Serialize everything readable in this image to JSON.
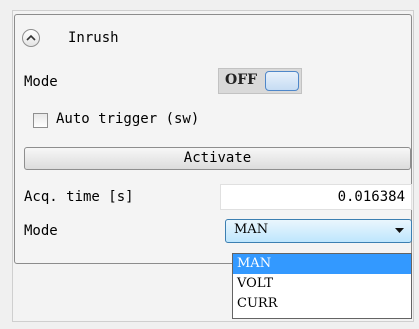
{
  "section": {
    "title": "Inrush",
    "icon": "chevron-up-icon"
  },
  "mode_toggle": {
    "label": "Mode",
    "state": "OFF"
  },
  "auto_trigger": {
    "label": "Auto trigger (sw)",
    "checked": false
  },
  "activate_button": {
    "label": "Activate"
  },
  "acq_time": {
    "label": "Acq. time [s]",
    "value": "0.016384"
  },
  "mode_select": {
    "label": "Mode",
    "selected": "MAN",
    "options": [
      "MAN",
      "VOLT",
      "CURR"
    ]
  },
  "colors": {
    "selection": "#3399ff",
    "accent": "#4f87c9"
  }
}
